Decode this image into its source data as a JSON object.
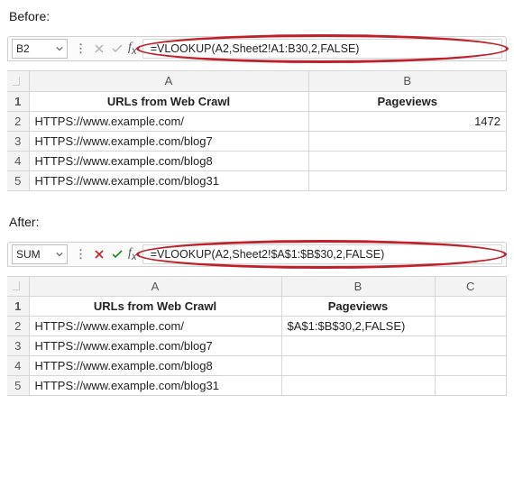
{
  "before": {
    "label": "Before:",
    "namebox": "B2",
    "formula": "=VLOOKUP(A2,Sheet2!A1:B30,2,FALSE)",
    "columns": [
      "A",
      "B"
    ],
    "headerRow": {
      "a": "URLs from Web Crawl",
      "b": "Pageviews"
    },
    "rows": [
      {
        "n": "2",
        "a": "HTTPS://www.example.com/",
        "b": "1472"
      },
      {
        "n": "3",
        "a": "HTTPS://www.example.com/blog7",
        "b": ""
      },
      {
        "n": "4",
        "a": "HTTPS://www.example.com/blog8",
        "b": ""
      },
      {
        "n": "5",
        "a": "HTTPS://www.example.com/blog31",
        "b": ""
      }
    ]
  },
  "after": {
    "label": "After:",
    "namebox": "SUM",
    "formula": "=VLOOKUP(A2,Sheet2!$A$1:$B$30,2,FALSE)",
    "columns": [
      "A",
      "B",
      "C"
    ],
    "headerRow": {
      "a": "URLs from Web Crawl",
      "b": "Pageviews",
      "c": ""
    },
    "rows": [
      {
        "n": "2",
        "a": "HTTPS://www.example.com/",
        "b": "$A$1:$B$30,2,FALSE)",
        "c": ""
      },
      {
        "n": "3",
        "a": "HTTPS://www.example.com/blog7",
        "b": "",
        "c": ""
      },
      {
        "n": "4",
        "a": "HTTPS://www.example.com/blog8",
        "b": "",
        "c": ""
      },
      {
        "n": "5",
        "a": "HTTPS://www.example.com/blog31",
        "b": "",
        "c": ""
      }
    ]
  }
}
